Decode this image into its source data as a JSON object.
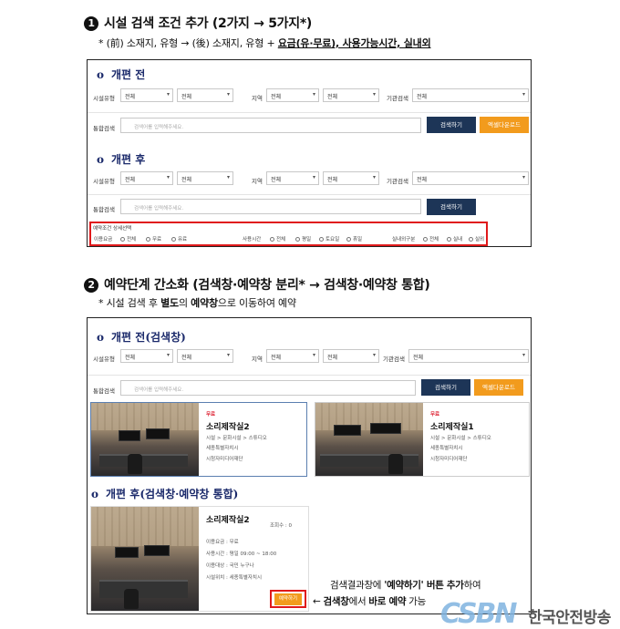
{
  "section1": {
    "number": "1",
    "heading": "시설 검색 조건 추가 (2가지 → 5가지*)",
    "note_prefix": "* (前) 소재지, 유형 → (後) 소재지, 유형 + ",
    "note_bold": "요금(유·무료), 사용가능시간, 실내외",
    "before": {
      "title": "개편 전",
      "label_type": "시설유형",
      "select_all": "전체",
      "label_region": "지역",
      "label_agency": "기관검색",
      "label_search": "통합검색",
      "search_placeholder": "검색어를 입력해주세요.",
      "search_button": "검색하기",
      "excel_button": "엑셀다운로드"
    },
    "after": {
      "title": "개편 후",
      "label_type": "시설유형",
      "select_all": "전체",
      "label_region": "지역",
      "label_agency": "기관검색",
      "label_search": "통합검색",
      "search_placeholder": "검색어를 입력해주세요.",
      "search_button": "검색하기",
      "detail_title": "예약조건 상세선택",
      "fee_label": "이용요금",
      "fee_options": [
        "전체",
        "무료",
        "유료"
      ],
      "time_label": "사용시간",
      "time_options": [
        "전체",
        "평일",
        "토요일",
        "휴일"
      ],
      "place_label": "실내외구분",
      "place_options": [
        "전체",
        "실내",
        "실외"
      ]
    }
  },
  "section2": {
    "number": "2",
    "heading": "예약단계 간소화 (검색창·예약창 분리* → 검색창·예약창 통합)",
    "note_a": "* 시설 검색 후 ",
    "note_b": "별도",
    "note_c": "의 ",
    "note_d": "예약창",
    "note_e": "으로 이동하여 예약",
    "before": {
      "title": "개편 전(검색창)",
      "label_type": "시설유형",
      "select_all": "전체",
      "label_region": "지역",
      "label_agency": "기관검색",
      "label_search": "통합검색",
      "search_placeholder": "검색어를 입력해주세요.",
      "search_button": "검색하기",
      "excel_button": "엑셀다운로드",
      "cards": [
        {
          "tag": "무료",
          "name": "소리제작실2",
          "category": "시설 > 문화시설 > 스튜디오",
          "address": "세종특별자치시",
          "agency": "시청자미디어재단"
        },
        {
          "tag": "무료",
          "name": "소리제작실1",
          "category": "시설 > 문화시설 > 스튜디오",
          "address": "세종특별자치시",
          "agency": "시청자미디어재단"
        }
      ]
    },
    "after": {
      "title": "개편 후(검색창·예약창 통합)",
      "room": "소리제작실2",
      "views": "조회수 : 0",
      "fee": "이용요금 : 무료",
      "hours": "사용시간 : 평일 09:00 ~ 18:00",
      "target": "이용대상 : 국민 누구나",
      "location": "시설위치 : 세종특별자치시",
      "reserve_button": "예약하기"
    },
    "callout_line1_a": "검색결과창에 ",
    "callout_line1_b": "'예약하기' 버튼 추가",
    "callout_line1_c": "하여",
    "callout_line2_a": "← ",
    "callout_line2_b": "검색창",
    "callout_line2_c": "에서 ",
    "callout_line2_d": "바로 예약",
    "callout_line2_e": " 가능"
  },
  "logo": {
    "mark": "CSBN",
    "name": "한국안전방송"
  },
  "colors": {
    "navy": "#1d3557",
    "orange": "#f29b1d",
    "red": "#e0191b",
    "title_blue": "#1b2a6b"
  }
}
